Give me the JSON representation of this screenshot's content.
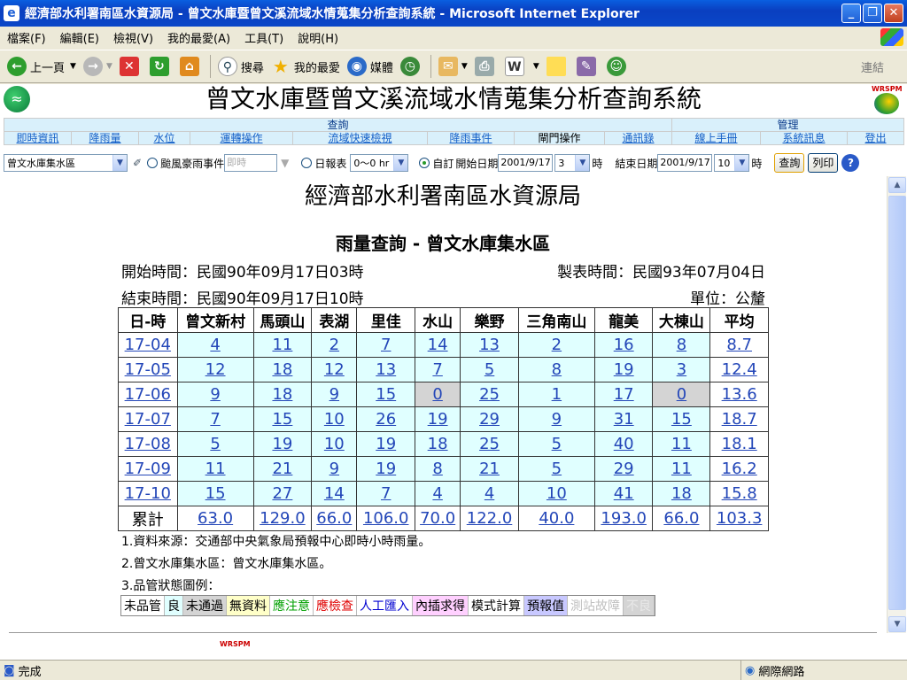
{
  "window": {
    "title": "經濟部水利署南區水資源局 - 曾文水庫暨曾文溪流域水情蒐集分析查詢系統 - Microsoft Internet Explorer"
  },
  "menu": [
    "檔案(F)",
    "編輯(E)",
    "檢視(V)",
    "我的最愛(A)",
    "工具(T)",
    "說明(H)"
  ],
  "toolbar": {
    "back": "上一頁",
    "search": "搜尋",
    "favorites": "我的最愛",
    "media": "媒體",
    "links": "連結"
  },
  "header": {
    "system_title": "曾文水庫暨曾文溪流域水情蒐集分析查詢系統",
    "wrspm": "WRSPM"
  },
  "nav": {
    "query_group": "查詢",
    "admin_group": "管理",
    "items": [
      "即時資訊",
      "降雨量",
      "水位",
      "運轉操作",
      "流域快速檢視",
      "降雨事件",
      "閘門操作",
      "通訊錄",
      "線上手冊",
      "系統訊息",
      "登出"
    ]
  },
  "controls": {
    "area_select": "曾文水庫集水區",
    "typhoon_label": "颱風豪雨事件",
    "typhoon_input": "即時",
    "daily_label": "日報表",
    "hour_range": "0～0 hr",
    "custom_label": "自訂",
    "start_label": "開始日期",
    "start_date": "2001/9/17",
    "start_hour": "3",
    "hour_unit": "時",
    "end_label": "結束日期",
    "end_date": "2001/9/17",
    "end_hour": "10",
    "query_button": "查詢",
    "print_button": "列印",
    "help_icon": "?"
  },
  "report": {
    "org": "經濟部水利署南區水資源局",
    "title": "雨量查詢 - 曾文水庫集水區",
    "start_time": "開始時間：民國90年09月17日03時",
    "end_time": "結束時間：民國90年09月17日10時",
    "made_time": "製表時間：民國93年07月04日",
    "unit": "單位：公釐"
  },
  "table": {
    "headers": [
      "日-時",
      "曾文新村",
      "馬頭山",
      "表湖",
      "里佳",
      "水山",
      "樂野",
      "三角南山",
      "龍美",
      "大棟山",
      "平均"
    ],
    "rows": [
      {
        "time": "17-04",
        "values": [
          "4",
          "11",
          "2",
          "7",
          "14",
          "13",
          "2",
          "16",
          "8",
          "8.7"
        ]
      },
      {
        "time": "17-05",
        "values": [
          "12",
          "18",
          "12",
          "13",
          "7",
          "5",
          "8",
          "19",
          "3",
          "12.4"
        ]
      },
      {
        "time": "17-06",
        "values": [
          "9",
          "18",
          "9",
          "15",
          "0",
          "25",
          "1",
          "17",
          "0",
          "13.6"
        ]
      },
      {
        "time": "17-07",
        "values": [
          "7",
          "15",
          "10",
          "26",
          "19",
          "29",
          "9",
          "31",
          "15",
          "18.7"
        ]
      },
      {
        "time": "17-08",
        "values": [
          "5",
          "19",
          "10",
          "19",
          "18",
          "25",
          "5",
          "40",
          "11",
          "18.1"
        ]
      },
      {
        "time": "17-09",
        "values": [
          "11",
          "21",
          "9",
          "19",
          "8",
          "21",
          "5",
          "29",
          "11",
          "16.2"
        ]
      },
      {
        "time": "17-10",
        "values": [
          "15",
          "27",
          "14",
          "7",
          "4",
          "4",
          "10",
          "41",
          "18",
          "15.8"
        ]
      }
    ],
    "total_label": "累計",
    "totals": [
      "63.0",
      "129.0",
      "66.0",
      "106.0",
      "70.0",
      "122.0",
      "40.0",
      "193.0",
      "66.0",
      "103.3"
    ]
  },
  "notes": [
    "1.資料來源：交通部中央氣象局預報中心即時小時雨量。",
    "2.曾文水庫集水區：曾文水庫集水區。",
    "3.品管狀態圖例："
  ],
  "legend": [
    {
      "label": "未品管",
      "bg": "#ffffff",
      "color": "#000000"
    },
    {
      "label": "良",
      "bg": "#e0ffff",
      "color": "#000000"
    },
    {
      "label": "未通過",
      "bg": "#d4d4d4",
      "color": "#000000"
    },
    {
      "label": "無資料",
      "bg": "#ffffc8",
      "color": "#000000"
    },
    {
      "label": "應注意",
      "bg": "#ffffff",
      "color": "#00a000"
    },
    {
      "label": "應檢查",
      "bg": "#ffffff",
      "color": "#e00000"
    },
    {
      "label": "人工匯入",
      "bg": "#ffffff",
      "color": "#0000d0"
    },
    {
      "label": "內插求得",
      "bg": "#ffd0ff",
      "color": "#000000"
    },
    {
      "label": "模式計算",
      "bg": "#ffffff",
      "color": "#000000"
    },
    {
      "label": "預報值",
      "bg": "#c8c8ff",
      "color": "#000000"
    },
    {
      "label": "測站故障",
      "bg": "#ffffff",
      "color": "#c0c0c0"
    },
    {
      "label": "不良",
      "bg": "#d4d4d4",
      "color": "#e8e8e8"
    }
  ],
  "footer_wrspm": "WRSPM",
  "status": {
    "text": "完成",
    "zone": "網際網路"
  }
}
